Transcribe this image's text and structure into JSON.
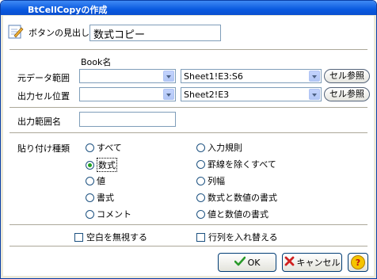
{
  "window": {
    "title": "BtCellCopyの作成"
  },
  "heading": {
    "label": "ボタンの見出し",
    "value": "数式コピー"
  },
  "book_header": "Book名",
  "source_range": {
    "label": "元データ範囲",
    "book": "",
    "range": "Sheet1!E3:S6",
    "ref_button": "セル参照"
  },
  "output_cell": {
    "label": "出力セル位置",
    "book": "",
    "range": "Sheet2!E3",
    "ref_button": "セル参照"
  },
  "output_range_name": {
    "label": "出力範囲名",
    "value": ""
  },
  "paste_type": {
    "label": "貼り付け種類",
    "options_left": [
      "すべて",
      "数式",
      "値",
      "書式",
      "コメント"
    ],
    "options_right": [
      "入力規則",
      "罫線を除くすべて",
      "列幅",
      "数式と数値の書式",
      "値と数値の書式"
    ],
    "selected": "数式"
  },
  "checks": {
    "skip_blanks": "空白を無視する",
    "transpose": "行列を入れ替える"
  },
  "buttons": {
    "ok": "OK",
    "cancel": "キャンセル",
    "help": "?"
  }
}
